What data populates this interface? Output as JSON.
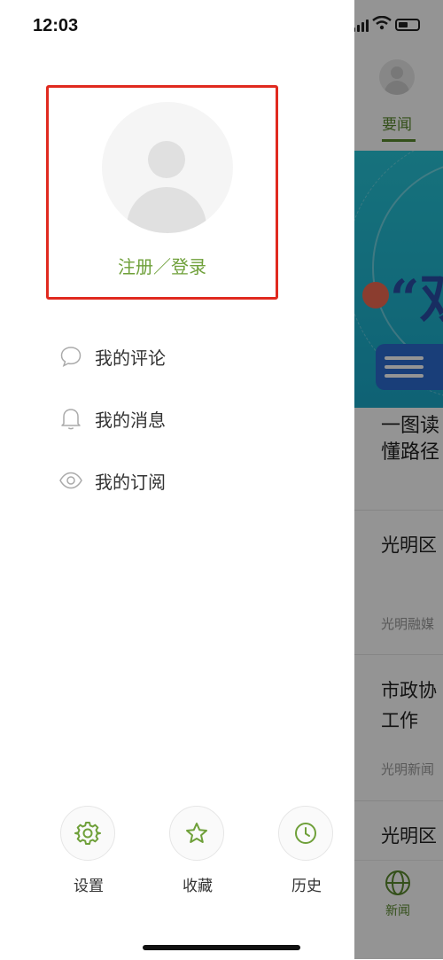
{
  "status_bar": {
    "time": "12:03"
  },
  "profile": {
    "login_text": "注册／登录"
  },
  "menu": [
    {
      "label": "我的评论",
      "icon": "comment-icon"
    },
    {
      "label": "我的消息",
      "icon": "bell-icon"
    },
    {
      "label": "我的订阅",
      "icon": "eye-icon"
    }
  ],
  "bottom_actions": [
    {
      "label": "设置",
      "icon": "gear-icon"
    },
    {
      "label": "收藏",
      "icon": "star-icon"
    },
    {
      "label": "历史",
      "icon": "clock-icon"
    }
  ],
  "background": {
    "tab": "要闻",
    "banner_text": "“双",
    "headline": "一图读懂路径",
    "articles": [
      {
        "title": "光明区",
        "source": "光明融媒"
      },
      {
        "title": "市政协",
        "title2": "工作",
        "source": "光明新闻"
      },
      {
        "title": "光明区"
      }
    ],
    "tabbar_label": "新闻"
  },
  "colors": {
    "accent": "#6fa03a",
    "highlight_border": "#e02a1f"
  }
}
